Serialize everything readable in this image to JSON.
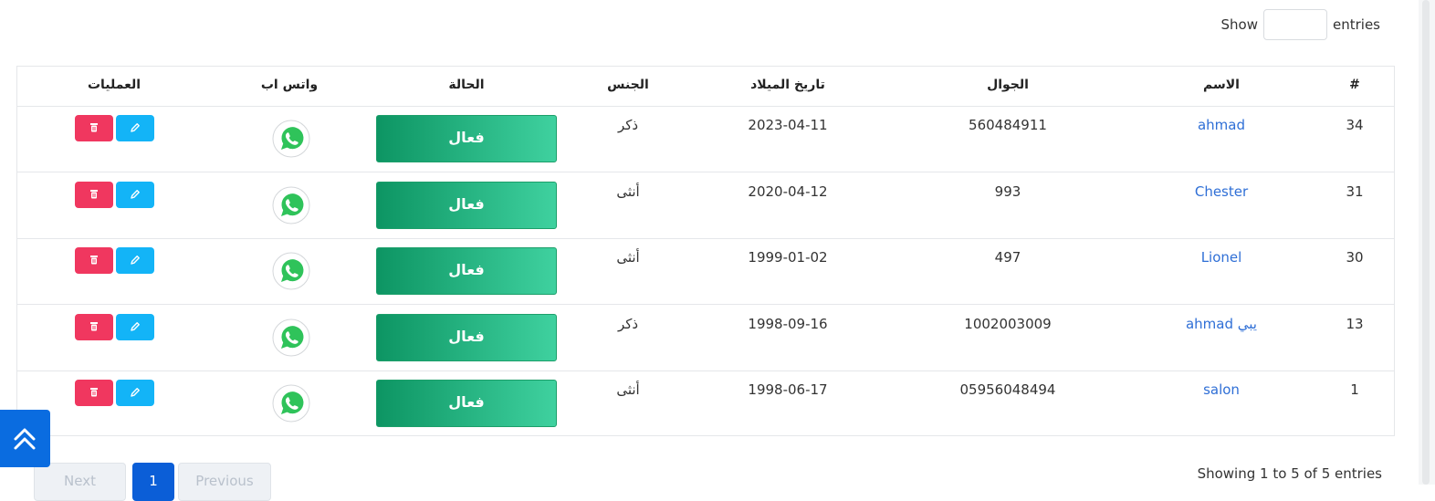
{
  "length_control": {
    "show_label": "Show",
    "entries_label": "entries",
    "value": ""
  },
  "table": {
    "headers": {
      "index": "#",
      "name": "الاسم",
      "mobile": "الجوال",
      "birthdate": "تاريخ الميلاد",
      "gender": "الجنس",
      "status": "الحالة",
      "whatsapp": "واتس اب",
      "actions": "العمليات"
    },
    "rows": [
      {
        "index": "34",
        "name": "ahmad",
        "mobile": "560484911",
        "birthdate": "2023-04-11",
        "gender": "ذكر",
        "status": "فعال"
      },
      {
        "index": "31",
        "name": "Chester",
        "mobile": "993",
        "birthdate": "2020-04-12",
        "gender": "أنثى",
        "status": "فعال"
      },
      {
        "index": "30",
        "name": "Lionel",
        "mobile": "497",
        "birthdate": "1999-01-02",
        "gender": "أنثى",
        "status": "فعال"
      },
      {
        "index": "13",
        "name": "ahmad يبي",
        "mobile": "1002003009",
        "birthdate": "1998-09-16",
        "gender": "ذكر",
        "status": "فعال"
      },
      {
        "index": "1",
        "name": "salon",
        "mobile": "05956048494",
        "birthdate": "1998-06-17",
        "gender": "أنثى",
        "status": "فعال"
      }
    ]
  },
  "icons": {
    "whatsapp": "whatsapp-icon",
    "delete": "trash-icon",
    "edit": "pencil-icon",
    "scroll_top": "double-chevron-up-icon"
  },
  "colors": {
    "status_start": "#0d9563",
    "status_end": "#3fd19f",
    "delete": "#f0375f",
    "edit": "#13b4f7",
    "link": "#2f6fd6",
    "primary": "#0b5ed7"
  },
  "info_text": "Showing 1 to 5 of 5 entries",
  "pagination": {
    "next": "Next",
    "current": "1",
    "previous": "Previous"
  }
}
